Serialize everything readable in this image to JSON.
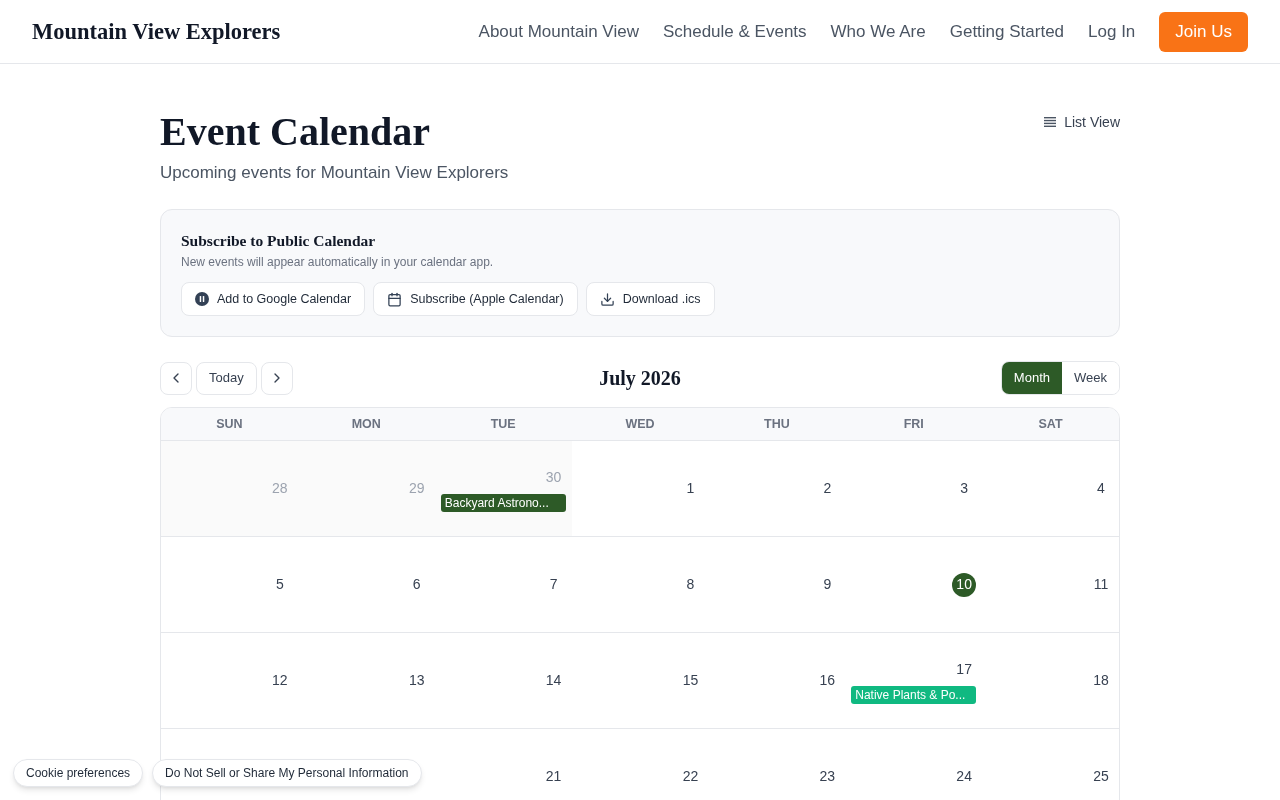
{
  "header": {
    "logo": "Mountain View Explorers",
    "nav": [
      "About Mountain View",
      "Schedule & Events",
      "Who We Are",
      "Getting Started",
      "Log In"
    ],
    "cta": "Join Us"
  },
  "page": {
    "title": "Event Calendar",
    "subtitle": "Upcoming events for Mountain View Explorers",
    "list_view_button": "List View"
  },
  "subscribe": {
    "title": "Subscribe to Public Calendar",
    "description": "New events will appear automatically in your calendar app.",
    "buttons": [
      {
        "label": "Add to Google Calendar",
        "kind": "google"
      },
      {
        "label": "Subscribe (Apple Calendar)",
        "kind": "apple"
      },
      {
        "label": "Download .ics",
        "kind": "download"
      }
    ]
  },
  "calendar": {
    "today_button": "Today",
    "title": "July 2026",
    "views": [
      {
        "label": "Month",
        "selected": true
      },
      {
        "label": "Week",
        "selected": false
      }
    ],
    "weekdays": [
      "SUN",
      "MON",
      "TUE",
      "WED",
      "THU",
      "FRI",
      "SAT"
    ],
    "weeks": [
      {
        "days": [
          {
            "day": "28",
            "outside": true,
            "today": false
          },
          {
            "day": "29",
            "outside": true,
            "today": false
          },
          {
            "day": "30",
            "outside": true,
            "today": false,
            "events": [
              {
                "title": "Backyard Astrono...",
                "color": "#2d5a27"
              }
            ]
          },
          {
            "day": "1",
            "outside": false,
            "today": false
          },
          {
            "day": "2",
            "outside": false,
            "today": false
          },
          {
            "day": "3",
            "outside": false,
            "today": false
          },
          {
            "day": "4",
            "outside": false,
            "today": false
          }
        ]
      },
      {
        "days": [
          {
            "day": "5",
            "outside": false,
            "today": false
          },
          {
            "day": "6",
            "outside": false,
            "today": false
          },
          {
            "day": "7",
            "outside": false,
            "today": false
          },
          {
            "day": "8",
            "outside": false,
            "today": false
          },
          {
            "day": "9",
            "outside": false,
            "today": false
          },
          {
            "day": "10",
            "outside": false,
            "today": true
          },
          {
            "day": "11",
            "outside": false,
            "today": false
          }
        ]
      },
      {
        "days": [
          {
            "day": "12",
            "outside": false,
            "today": false
          },
          {
            "day": "13",
            "outside": false,
            "today": false
          },
          {
            "day": "14",
            "outside": false,
            "today": false
          },
          {
            "day": "15",
            "outside": false,
            "today": false
          },
          {
            "day": "16",
            "outside": false,
            "today": false
          },
          {
            "day": "17",
            "outside": false,
            "today": false,
            "events": [
              {
                "title": "Native Plants & Po...",
                "color": "#10b981"
              }
            ]
          },
          {
            "day": "18",
            "outside": false,
            "today": false
          }
        ]
      },
      {
        "days": [
          {
            "day": "21",
            "outside": false,
            "today": false
          },
          {
            "day": "22",
            "outside": false,
            "today": false
          },
          {
            "day": "23",
            "outside": false,
            "today": false
          },
          {
            "day": "24",
            "outside": false,
            "today": false
          },
          {
            "day": "25",
            "outside": false,
            "today": false
          }
        ]
      }
    ]
  },
  "cookie_buttons": [
    "Cookie preferences",
    "Do Not Sell or Share My Personal Information"
  ]
}
